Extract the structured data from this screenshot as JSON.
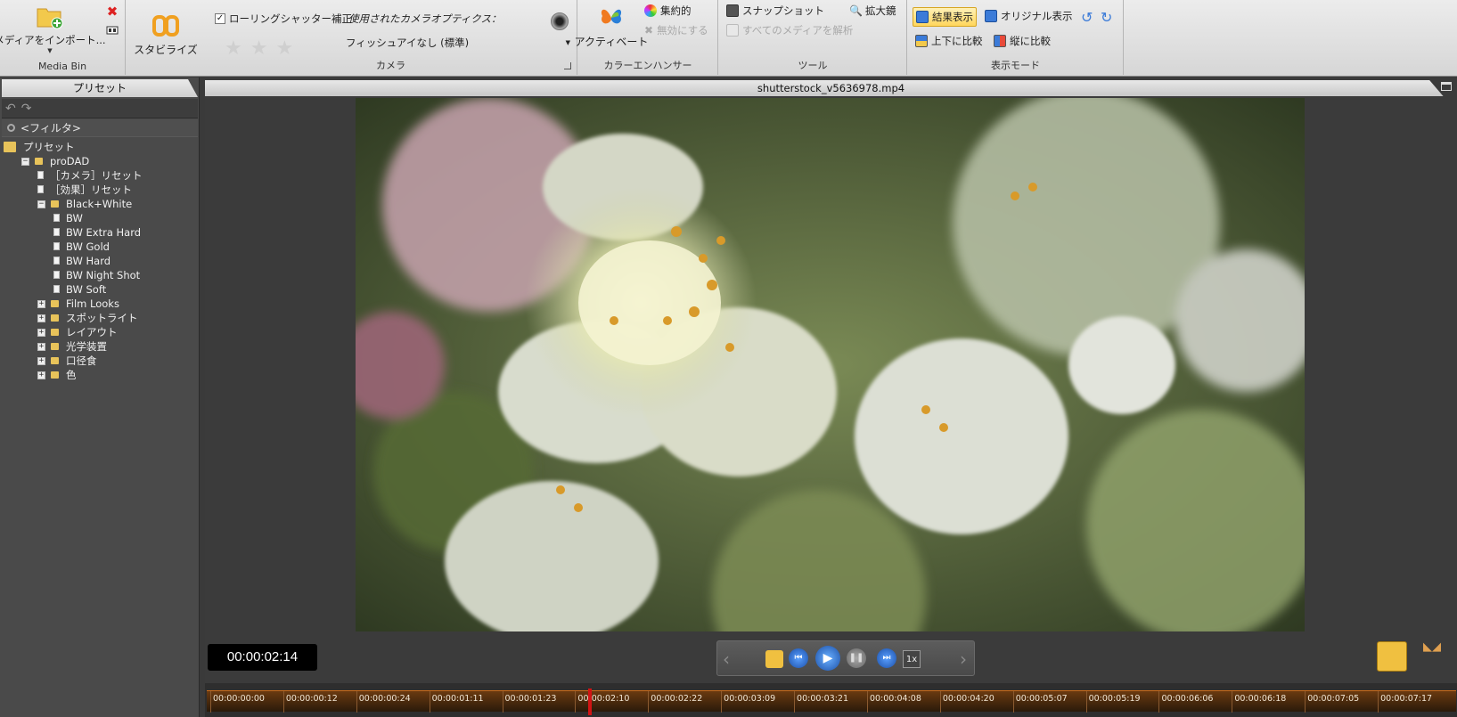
{
  "ribbon": {
    "media_bin": {
      "import_label": "メディアをインポート...",
      "group_label": "Media Bin"
    },
    "stabilize": {
      "label": "スタビライズ"
    },
    "camera": {
      "rolling_shutter_label": "ローリングシャッター補正",
      "rolling_shutter_checked": true,
      "optics_label": "使用されたカメラオプティクス：",
      "optics_value": "フィッシュアイなし (標準)",
      "group_label": "カメラ"
    },
    "color_enhancer": {
      "activate_label": "アクティベート",
      "intensive_label": "集約的",
      "disable_label": "無効にする",
      "group_label": "カラーエンハンサー"
    },
    "tools": {
      "snapshot_label": "スナップショット",
      "magnifier_label": "拡大鏡",
      "analyze_all_label": "すべてのメディアを解析",
      "group_label": "ツール"
    },
    "view_mode": {
      "result_label": "結果表示",
      "original_label": "オリジナル表示",
      "compare_tb_label": "上下に比較",
      "compare_lr_label": "縦に比較",
      "group_label": "表示モード"
    }
  },
  "left_panel": {
    "tab_label": "プリセット",
    "filter_placeholder": "<フィルタ>",
    "tree": [
      {
        "label": "プリセット",
        "level": 0,
        "type": "root"
      },
      {
        "label": "proDAD",
        "level": 1,
        "type": "folder",
        "expanded": true
      },
      {
        "label": "［カメラ］リセット",
        "level": 2,
        "type": "doc"
      },
      {
        "label": "［効果］リセット",
        "level": 2,
        "type": "doc"
      },
      {
        "label": "Black+White",
        "level": 2,
        "type": "folder",
        "expanded": true
      },
      {
        "label": "BW",
        "level": 3,
        "type": "doc"
      },
      {
        "label": "BW Extra Hard",
        "level": 3,
        "type": "doc"
      },
      {
        "label": "BW Gold",
        "level": 3,
        "type": "doc"
      },
      {
        "label": "BW Hard",
        "level": 3,
        "type": "doc"
      },
      {
        "label": "BW Night Shot",
        "level": 3,
        "type": "doc"
      },
      {
        "label": "BW Soft",
        "level": 3,
        "type": "doc"
      },
      {
        "label": "Film Looks",
        "level": 2,
        "type": "folder",
        "expanded": false
      },
      {
        "label": "スポットライト",
        "level": 2,
        "type": "folder",
        "expanded": false
      },
      {
        "label": "レイアウト",
        "level": 2,
        "type": "folder",
        "expanded": false
      },
      {
        "label": "光学装置",
        "level": 2,
        "type": "folder",
        "expanded": false
      },
      {
        "label": "口径食",
        "level": 2,
        "type": "folder",
        "expanded": false
      },
      {
        "label": "色",
        "level": 2,
        "type": "folder",
        "expanded": false
      }
    ]
  },
  "main": {
    "file_name": "shutterstock_v5636978.mp4",
    "timecode": "00:00:02:14",
    "speed_label": "1x",
    "timeline": {
      "labels": [
        "00:00:00:00",
        "00:00:00:12",
        "00:00:00:24",
        "00:00:01:11",
        "00:00:01:23",
        "00:00:02:10",
        "00:00:02:22",
        "00:00:03:09",
        "00:00:03:21",
        "00:00:04:08",
        "00:00:04:20",
        "00:00:05:07",
        "00:00:05:19",
        "00:00:06:06",
        "00:00:06:18",
        "00:00:07:05",
        "00:00:07:17"
      ],
      "playhead_fraction": 0.305
    }
  },
  "colors": {
    "ribbon_bg": "#dcdcdc",
    "panel_bg": "#4a4a4a",
    "timeline_orange": "#c76a1a",
    "playhead": "#d21414",
    "highlight": "#ffd65c"
  }
}
